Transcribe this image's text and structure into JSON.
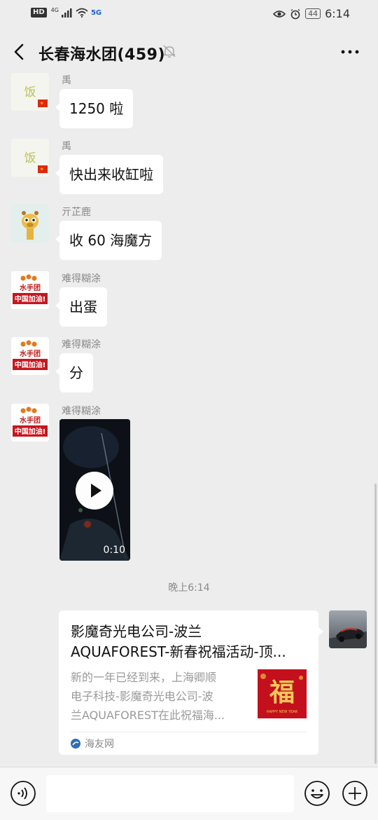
{
  "status_bar": {
    "left_badge": "HD",
    "signal_label": "4G",
    "network": "5G",
    "battery": "44",
    "time": "6:14"
  },
  "nav": {
    "title": "长春海水团(459)",
    "back_icon": "chevron-left-icon",
    "mute_icon": "bell-off-icon",
    "more_icon": "more-dots-icon"
  },
  "messages": [
    {
      "sender": "禹",
      "text": "1250 啦",
      "avatar": "yu"
    },
    {
      "sender": "禹",
      "text": "快出来收缸啦",
      "avatar": "yu"
    },
    {
      "sender": "亓芷鹿",
      "text": "收 60 海魔方",
      "avatar": "deer"
    },
    {
      "sender": "难得糊涂",
      "text": "出蛋",
      "avatar": "team"
    },
    {
      "sender": "难得糊涂",
      "text": "分",
      "avatar": "team"
    },
    {
      "sender": "难得糊涂",
      "video_duration": "0:10",
      "avatar": "team"
    }
  ],
  "avatar_text": {
    "team_top": "水手团",
    "team_bottom": "中国加油!",
    "yu_glyph": "饭"
  },
  "time_divider": "晚上6:14",
  "shared_card": {
    "title_line1": "影魔奇光电公司-波兰",
    "title_line2": "AQUAFOREST-新春祝福活动-顶...",
    "desc_line1": "新的一年已经到来，上海卿顺",
    "desc_line2": "电子科技-影魔奇光电公司-波",
    "desc_line3": "兰AQUAFOREST在此祝福海...",
    "thumb_glyph": "福",
    "thumb_caption": "HAPPY NEW YEAR",
    "source": "海友网"
  },
  "input_bar": {
    "voice_icon": "voice-icon",
    "emoji_icon": "emoji-icon",
    "plus_icon": "plus-icon"
  }
}
